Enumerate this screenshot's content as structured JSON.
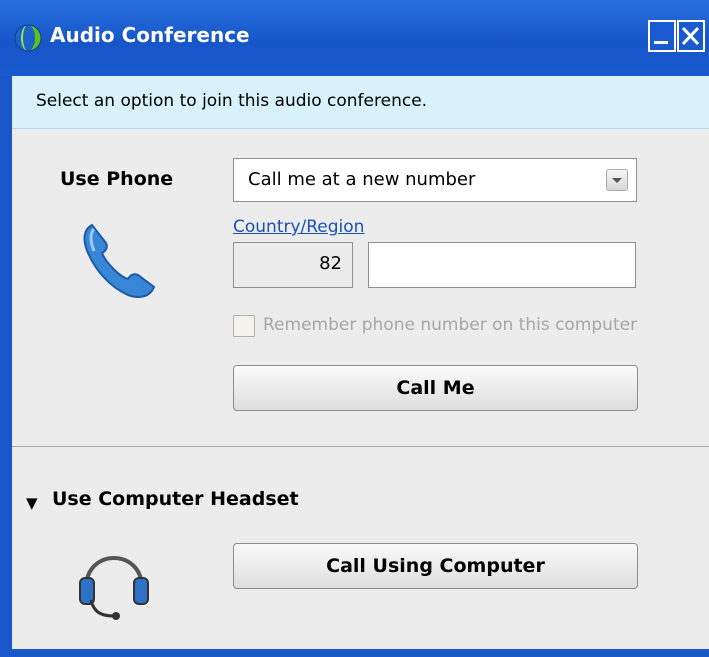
{
  "window": {
    "title": "Audio Conference",
    "icon": "globe-icon",
    "controls": [
      "minimize-icon",
      "close-icon"
    ]
  },
  "banner": {
    "text": "Select an option to join this audio conference."
  },
  "phone_section": {
    "label": "Use Phone",
    "icon": "phone-handset-icon",
    "dropdown_value": "Call me at a new number",
    "country_link": "Country/Region",
    "country_code": "82",
    "phone_number": "",
    "remember_label": "Remember phone number on this computer",
    "remember_checked": false,
    "call_button": "Call Me"
  },
  "computer_section": {
    "expand_icon": "▼",
    "label": "Use Computer Headset",
    "icon": "headset-icon",
    "call_button": "Call Using Computer"
  },
  "colors": {
    "titlebar": "#1a5ad0",
    "banner": "#d8f1fb",
    "panel": "#ececec",
    "link": "#1a50b8",
    "phone_icon": "#2f7fcf"
  }
}
